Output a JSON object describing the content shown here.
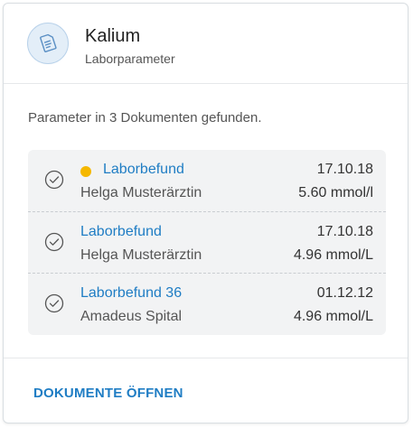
{
  "card": {
    "title": "Kalium",
    "subtitle": "Laborparameter",
    "avatar_icon": "lab-document-icon"
  },
  "summary_text": "Parameter in 3 Dokumenten gefunden.",
  "documents": [
    {
      "name": "Laborbefund",
      "source": "Helga Musterärztin",
      "date": "17.10.18",
      "value": "5.60 mmol/l",
      "flag": "unread",
      "flag_color": "#f5b800"
    },
    {
      "name": "Laborbefund",
      "source": "Helga Musterärztin",
      "date": "17.10.18",
      "value": "4.96 mmol/L"
    },
    {
      "name": "Laborbefund 36",
      "source": "Amadeus Spital",
      "date": "01.12.12",
      "value": "4.96 mmol/L"
    }
  ],
  "actions": {
    "open_documents": "DOKUMENTE ÖFFNEN"
  },
  "colors": {
    "link": "#1f7dc4",
    "list_background": "#f2f3f4",
    "avatar_background": "#e3eef8"
  }
}
